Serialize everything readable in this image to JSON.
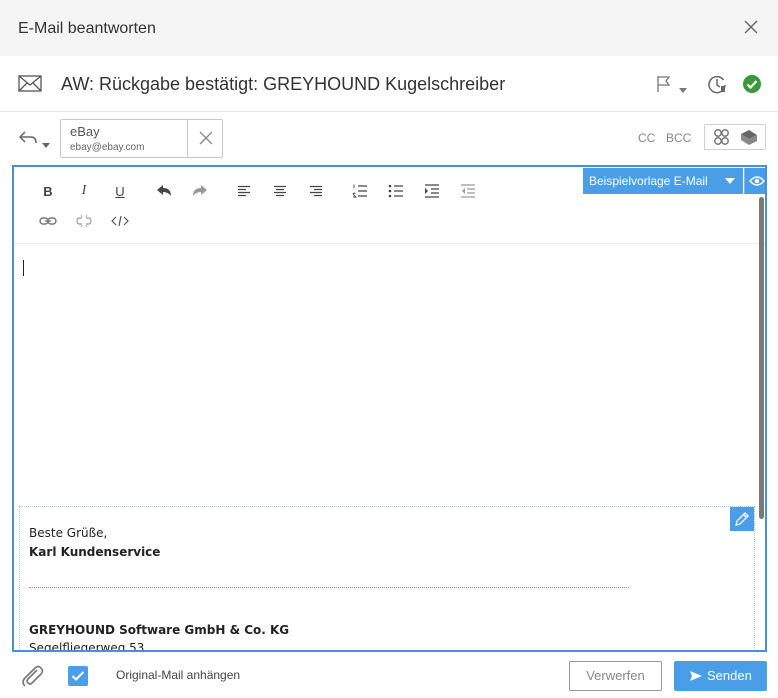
{
  "dialog": {
    "title": "E-Mail beantworten"
  },
  "subject": {
    "text": "AW: Rückgabe bestätigt: GREYHOUND Kugelschreiber"
  },
  "recipient": {
    "name": "eBay",
    "email": "ebay@ebay.com"
  },
  "fields": {
    "cc_label": "CC",
    "bcc_label": "BCC"
  },
  "template": {
    "selected": "Beispielvorlage E-Mail"
  },
  "signature": {
    "greeting": "Beste Grüße,",
    "sender": "Karl Kundenservice",
    "company": "GREYHOUND Software GmbH & Co. KG",
    "street": "Segelfliegerweg 53"
  },
  "footer": {
    "attach_original_label": "Original-Mail anhängen",
    "attach_original_checked": true,
    "discard_label": "Verwerfen",
    "send_label": "Senden"
  },
  "colors": {
    "accent": "#4a9ee8",
    "focus_border": "#4a90d9",
    "success": "#3a9a3a"
  },
  "icons": {
    "close": "close-icon",
    "mail": "envelope-icon",
    "flag": "flag-icon",
    "time": "clock-icon",
    "done": "check-circle-icon",
    "reply": "reply-icon",
    "remove": "close-icon",
    "address_book": "address-book-icon",
    "preview": "eye-icon",
    "edit": "pencil-icon",
    "attachment": "paperclip-icon",
    "send": "send-icon"
  }
}
